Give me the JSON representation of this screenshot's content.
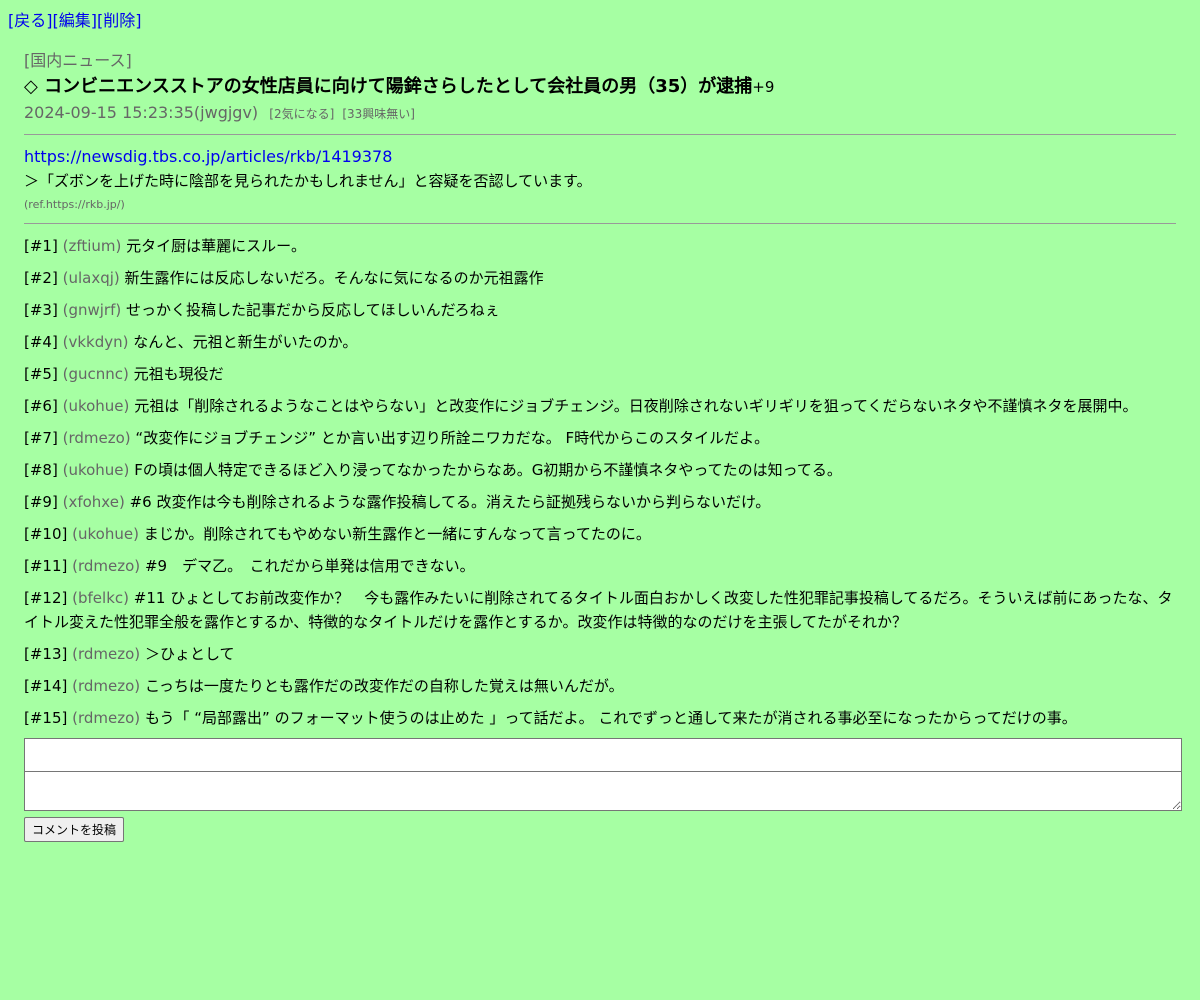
{
  "nav": {
    "back": "戻る",
    "edit": "編集",
    "delete": "削除"
  },
  "article": {
    "category": "[国内ニュース]",
    "title": "◇ コンビニエンスストアの女性店員に向けて陽鉾さらしたとして会社員の男（35）が逮捕",
    "plus": "+9",
    "datetime": "2024-09-15 15:23:35(jwgjgv)",
    "vote_concern": "[2気になる]",
    "vote_no_interest": "[33興味無い]",
    "url": "https://newsdig.tbs.co.jp/articles/rkb/1419378",
    "quote": "＞「ズボンを上げた時に陰部を見られたかもしれません」と容疑を否認しています。",
    "ref": "(ref.https://rkb.jp/)"
  },
  "comments": [
    {
      "num": "[#1]",
      "uid": "(zftium)",
      "text": "元タイ厨は華麗にスルー。"
    },
    {
      "num": "[#2]",
      "uid": "(ulaxqj)",
      "text": "新生露作には反応しないだろ。そんなに気になるのか元祖露作"
    },
    {
      "num": "[#3]",
      "uid": "(gnwjrf)",
      "text": "せっかく投稿した記事だから反応してほしいんだろねぇ"
    },
    {
      "num": "[#4]",
      "uid": "(vkkdyn)",
      "text": "なんと、元祖と新生がいたのか。"
    },
    {
      "num": "[#5]",
      "uid": "(gucnnc)",
      "text": "元祖も現役だ"
    },
    {
      "num": "[#6]",
      "uid": "(ukohue)",
      "text": "元祖は「削除されるようなことはやらない」と改変作にジョブチェンジ。日夜削除されないギリギリを狙ってくだらないネタや不謹慎ネタを展開中。"
    },
    {
      "num": "[#7]",
      "uid": "(rdmezo)",
      "text": "“改変作にジョブチェンジ” とか言い出す辺り所詮ニワカだな。 F時代からこのスタイルだよ。"
    },
    {
      "num": "[#8]",
      "uid": "(ukohue)",
      "text": "Fの頃は個人特定できるほど入り浸ってなかったからなあ。G初期から不謹慎ネタやってたのは知ってる。"
    },
    {
      "num": "[#9]",
      "uid": "(xfohxe)",
      "text": "#6 改変作は今も削除されるような露作投稿してる。消えたら証拠残らないから判らないだけ。"
    },
    {
      "num": "[#10]",
      "uid": "(ukohue)",
      "text": "まじか。削除されてもやめない新生露作と一緒にすんなって言ってたのに。"
    },
    {
      "num": "[#11]",
      "uid": "(rdmezo)",
      "text": "#9　デマ乙。　これだから単発は信用できない。"
    },
    {
      "num": "[#12]",
      "uid": "(bfelkc)",
      "text": "#11 ひょとしてお前改変作か？　今も露作みたいに削除されてるタイトル面白おかしく改変した性犯罪記事投稿してるだろ。そういえば前にあったな、タイトル変えた性犯罪全般を露作とするか、特徴的なタイトルだけを露作とするか。改変作は特徴的なのだけを主張してたがそれか？"
    },
    {
      "num": "[#13]",
      "uid": "(rdmezo)",
      "text": "＞ひょとして"
    },
    {
      "num": "[#14]",
      "uid": "(rdmezo)",
      "text": "こっちは一度たりとも露作だの改変作だの自称した覚えは無いんだが。"
    },
    {
      "num": "[#15]",
      "uid": "(rdmezo)",
      "text": "もう「 “局部露出” のフォーマット使うのは止めた 」って話だよ。 これでずっと通して来たが消される事必至になったからってだけの事。"
    }
  ],
  "form": {
    "name_value": "",
    "body_value": "",
    "submit_label": "コメントを投稿"
  }
}
